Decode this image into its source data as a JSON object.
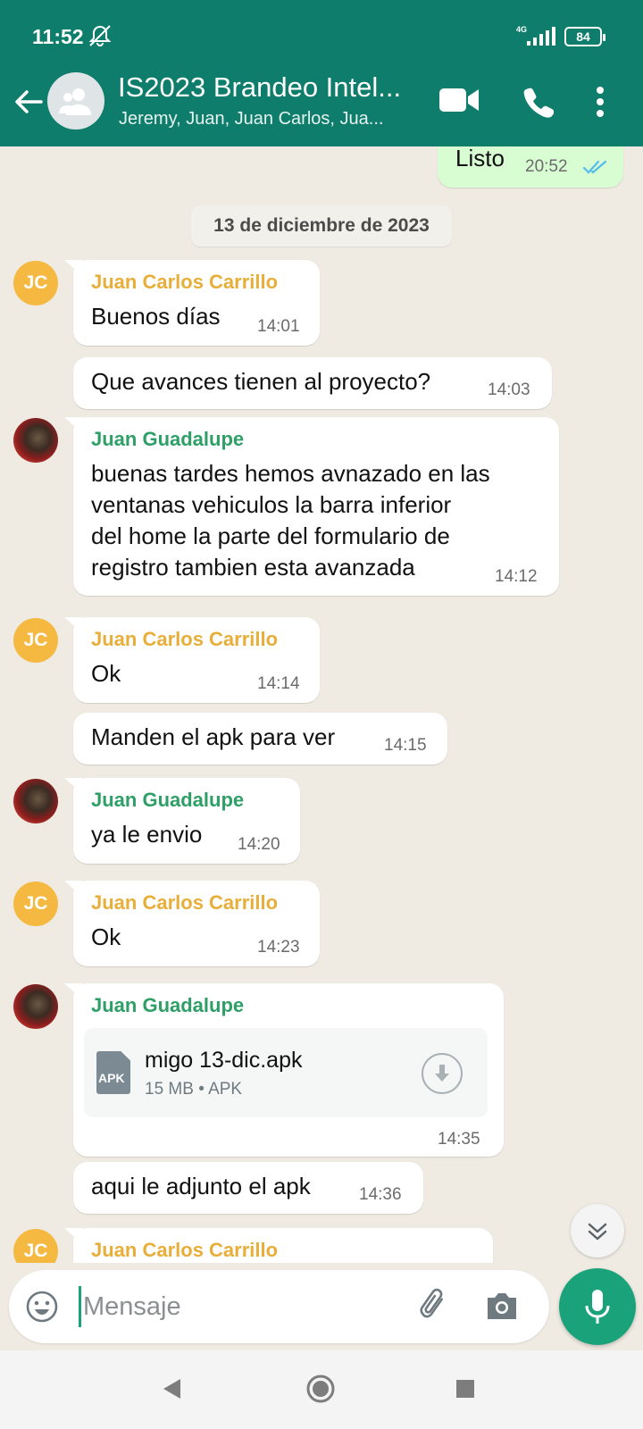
{
  "status_bar": {
    "time": "11:52",
    "network": "4G",
    "battery": "84"
  },
  "header": {
    "title": "IS2023 Brandeo Intel...",
    "subtitle": "Jeremy, Juan, Juan Carlos, Jua..."
  },
  "colors": {
    "header": "#0f7d6b",
    "accent": "#1aa37a",
    "chat_bg": "#efeae2",
    "outgoing": "#d9fdd3",
    "sender_yellow": "#e8ae3a",
    "sender_green": "#2e9f66"
  },
  "chat": {
    "top_out": {
      "text": "Listo",
      "time": "20:52"
    },
    "date": "13 de diciembre de 2023",
    "messages": [
      {
        "initials": "JC",
        "sender": "Juan Carlos Carrillo",
        "text": "Buenos días",
        "time": "14:01"
      },
      {
        "text": "Que avances tienen al proyecto?",
        "time": "14:03"
      },
      {
        "sender": "Juan Guadalupe",
        "text_lines": [
          "buenas tardes hemos avnazado en las",
          "ventanas vehiculos la barra inferior",
          "del home la parte del formulario de",
          "registro tambien esta avanzada"
        ],
        "time": "14:12"
      },
      {
        "initials": "JC",
        "sender": "Juan Carlos Carrillo",
        "text": "Ok",
        "time": "14:14"
      },
      {
        "text": "Manden el apk para ver",
        "time": "14:15"
      },
      {
        "sender": "Juan Guadalupe",
        "text": "ya le envio",
        "time": "14:20"
      },
      {
        "initials": "JC",
        "sender": "Juan Carlos Carrillo",
        "text": "Ok",
        "time": "14:23"
      },
      {
        "sender": "Juan Guadalupe",
        "file": {
          "icon_label": "APK",
          "name": "migo 13-dic.apk",
          "meta": "15 MB • APK"
        },
        "time": "14:35"
      },
      {
        "text": "aqui le adjunto el apk",
        "time": "14:36"
      },
      {
        "initials": "JC",
        "sender": "Juan Carlos Carrillo"
      }
    ]
  },
  "composer": {
    "placeholder": "Mensaje"
  },
  "icons": [
    "back-arrow-icon",
    "group-avatar-icon",
    "video-call-icon",
    "phone-icon",
    "more-vert-icon",
    "emoji-icon",
    "attach-icon",
    "camera-icon",
    "mic-icon",
    "scroll-down-icon",
    "nav-back-icon",
    "nav-home-icon",
    "nav-recents-icon"
  ]
}
